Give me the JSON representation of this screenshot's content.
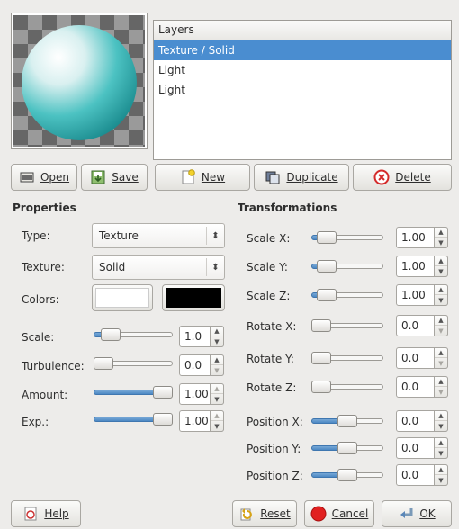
{
  "layers": {
    "header": "Layers",
    "items": [
      "Texture / Solid",
      "Light",
      "Light"
    ],
    "selected_index": 0
  },
  "preview_buttons": {
    "open": "Open",
    "save": "Save"
  },
  "layer_buttons": {
    "new": "New",
    "duplicate": "Duplicate",
    "delete": "Delete"
  },
  "properties": {
    "heading": "Properties",
    "type_label": "Type:",
    "type_value": "Texture",
    "texture_label": "Texture:",
    "texture_value": "Solid",
    "colors_label": "Colors:",
    "color1": "#ffffff",
    "color2": "#000000",
    "scale_label": "Scale:",
    "scale_value": "1.0",
    "scale_level": 0.1,
    "turbulence_label": "Turbulence:",
    "turbulence_value": "0.0",
    "turbulence_level": 0.0,
    "amount_label": "Amount:",
    "amount_value": "1.00",
    "amount_level": 1.0,
    "exp_label": "Exp.:",
    "exp_value": "1.00",
    "exp_level": 1.0
  },
  "transformations": {
    "heading": "Transformations",
    "rows": [
      {
        "label": "Scale X:",
        "value": "1.00",
        "level": 0.1,
        "filled": false
      },
      {
        "label": "Scale Y:",
        "value": "1.00",
        "level": 0.1,
        "filled": false
      },
      {
        "label": "Scale Z:",
        "value": "1.00",
        "level": 0.1,
        "filled": false
      },
      {
        "label": "Rotate X:",
        "value": "0.0",
        "level": 0.0,
        "filled": false
      },
      {
        "label": "Rotate Y:",
        "value": "0.0",
        "level": 0.0,
        "filled": false
      },
      {
        "label": "Rotate Z:",
        "value": "0.0",
        "level": 0.0,
        "filled": false
      },
      {
        "label": "Position X:",
        "value": "0.0",
        "level": 0.5,
        "filled": true
      },
      {
        "label": "Position Y:",
        "value": "0.0",
        "level": 0.5,
        "filled": true
      },
      {
        "label": "Position Z:",
        "value": "0.0",
        "level": 0.5,
        "filled": true
      }
    ]
  },
  "footer": {
    "help": "Help",
    "reset": "Reset",
    "cancel": "Cancel",
    "ok": "OK"
  },
  "colors": {
    "selection": "#4a8dd0",
    "sphere": "#3cbcbc"
  }
}
